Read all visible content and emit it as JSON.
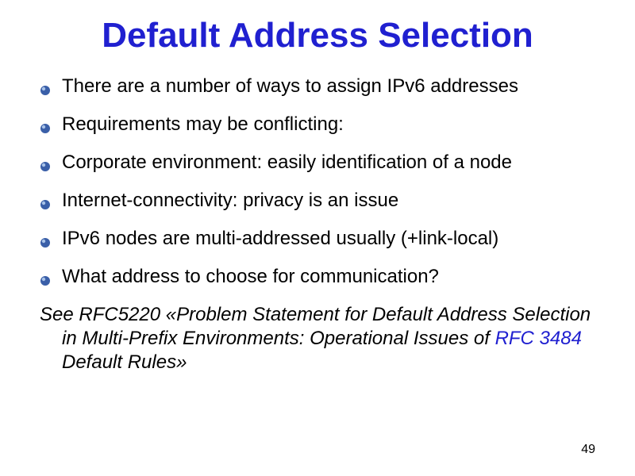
{
  "title": "Default Address Selection",
  "bullets": [
    "There are a number of ways to assign IPv6 addresses",
    "Requirements may be conflicting:",
    "Corporate environment: easily identification of a node",
    "Internet-connectivity: privacy is an issue",
    "IPv6 nodes are multi-addressed usually (+link-local)",
    "What address to choose for communication?"
  ],
  "note": {
    "prefix": "See RFC5220 «Problem Statement for Default Address Selection in Multi-Prefix Environments: Operational Issues of ",
    "link_text": "RFC 3484",
    "suffix": " Default Rules»"
  },
  "page_number": "49",
  "colors": {
    "accent": "#2020d0",
    "bullet_fill": "#3a5fa8",
    "bullet_highlight": "#a9c3e8"
  }
}
